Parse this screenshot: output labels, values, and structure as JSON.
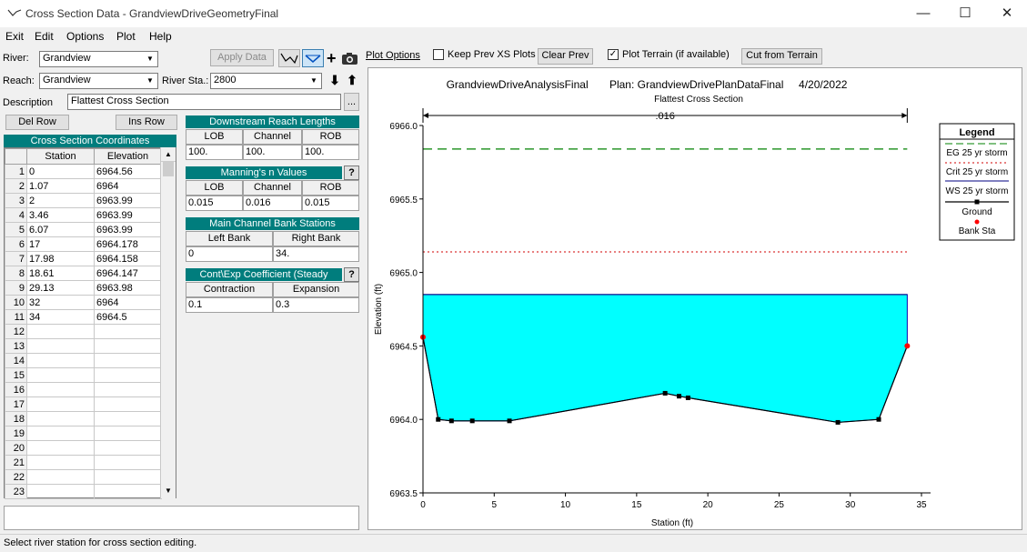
{
  "window": {
    "title": "Cross Section Data - GrandviewDriveGeometryFinal",
    "min": "—",
    "max": "☐",
    "close": "✕"
  },
  "menu": [
    "Exit",
    "Edit",
    "Options",
    "Plot",
    "Help"
  ],
  "river": {
    "label": "River:",
    "value": "Grandview"
  },
  "reach": {
    "label": "Reach:",
    "value": "Grandview"
  },
  "river_sta": {
    "label": "River Sta.:",
    "value": "2800"
  },
  "apply_data": "Apply Data",
  "description": {
    "label": "Description",
    "value": "Flattest Cross Section"
  },
  "ellipsis": "...",
  "del_row": "Del Row",
  "ins_row": "Ins Row",
  "coords": {
    "title": "Cross Section Coordinates",
    "headers": [
      "Station",
      "Elevation"
    ],
    "rows": [
      [
        "1",
        "0",
        "6964.56"
      ],
      [
        "2",
        "1.07",
        "6964"
      ],
      [
        "3",
        "2",
        "6963.99"
      ],
      [
        "4",
        "3.46",
        "6963.99"
      ],
      [
        "5",
        "6.07",
        "6963.99"
      ],
      [
        "6",
        "17",
        "6964.178"
      ],
      [
        "7",
        "17.98",
        "6964.158"
      ],
      [
        "8",
        "18.61",
        "6964.147"
      ],
      [
        "9",
        "29.13",
        "6963.98"
      ],
      [
        "10",
        "32",
        "6964"
      ],
      [
        "11",
        "34",
        "6964.5"
      ],
      [
        "12",
        "",
        ""
      ],
      [
        "13",
        "",
        ""
      ],
      [
        "14",
        "",
        ""
      ],
      [
        "15",
        "",
        ""
      ],
      [
        "16",
        "",
        ""
      ],
      [
        "17",
        "",
        ""
      ],
      [
        "18",
        "",
        ""
      ],
      [
        "19",
        "",
        ""
      ],
      [
        "20",
        "",
        ""
      ],
      [
        "21",
        "",
        ""
      ],
      [
        "22",
        "",
        ""
      ],
      [
        "23",
        "",
        ""
      ]
    ]
  },
  "reach_lengths": {
    "title": "Downstream Reach Lengths",
    "headers": [
      "LOB",
      "Channel",
      "ROB"
    ],
    "values": [
      "100.",
      "100.",
      "100."
    ]
  },
  "mannings": {
    "title": "Manning's n Values",
    "headers": [
      "LOB",
      "Channel",
      "ROB"
    ],
    "values": [
      "0.015",
      "0.016",
      "0.015"
    ]
  },
  "bank_stations": {
    "title": "Main Channel Bank Stations",
    "headers": [
      "Left Bank",
      "Right Bank"
    ],
    "values": [
      "0",
      "34."
    ]
  },
  "cont_exp": {
    "title": "Cont\\Exp Coefficient (Steady",
    "headers": [
      "Contraction",
      "Expansion"
    ],
    "values": [
      "0.1",
      "0.3"
    ]
  },
  "help_glyph": "?",
  "plot_options": "Plot Options",
  "keep_prev": "Keep Prev XS Plots",
  "clear_prev": "Clear Prev",
  "plot_terrain": "Plot Terrain (if available)",
  "cut_terrain": "Cut from Terrain",
  "status_text": "Select river station for cross section editing.",
  "colors": {
    "water": "#00ffff",
    "teal": "#007d7d",
    "eg": "#008000",
    "crit": "#d00000",
    "ground": "#000000",
    "bank": "#ff0000"
  },
  "icons": [
    "draw-xs-icon",
    "water-surface-icon",
    "plus-icon",
    "camera-icon",
    "arrow-down-icon",
    "arrow-up-icon"
  ],
  "chart_data": {
    "type": "line",
    "title": "GrandviewDriveAnalysisFinal       Plan: GrandviewDrivePlanDataFinal     4/20/2022",
    "subtitle": "Flattest Cross Section",
    "xlabel": "Station (ft)",
    "ylabel": "Elevation (ft)",
    "xlim": [
      0,
      35
    ],
    "ylim": [
      6963.5,
      6966.0
    ],
    "xticks": [
      0,
      5,
      10,
      15,
      20,
      25,
      30,
      35
    ],
    "yticks": [
      6963.5,
      6964.0,
      6964.5,
      6965.0,
      6965.5,
      6966.0
    ],
    "ytick_labels": [
      "6963.5",
      "6964.0",
      "6964.5",
      "6965.0",
      "6965.5",
      "6966.0"
    ],
    "n_label": ".016",
    "legend": {
      "title": "Legend",
      "placement": "right",
      "items": [
        "EG 25 yr storm",
        "Crit 25 yr storm",
        "WS 25 yr storm",
        "Ground",
        "Bank Sta"
      ]
    },
    "series": [
      {
        "name": "Ground",
        "x": [
          0,
          1.07,
          2,
          3.46,
          6.07,
          17,
          17.98,
          18.61,
          29.13,
          32,
          34
        ],
        "y": [
          6964.56,
          6964,
          6963.99,
          6963.99,
          6963.99,
          6964.178,
          6964.158,
          6964.147,
          6963.98,
          6964,
          6964.5
        ]
      },
      {
        "name": "EG 25 yr storm",
        "x": [
          0,
          34
        ],
        "y": [
          6965.84,
          6965.84
        ]
      },
      {
        "name": "Crit 25 yr storm",
        "x": [
          0,
          34
        ],
        "y": [
          6965.14,
          6965.14
        ]
      },
      {
        "name": "WS 25 yr storm",
        "x": [
          0,
          34
        ],
        "y": [
          6964.85,
          6964.85
        ]
      },
      {
        "name": "Bank Sta",
        "x": [
          0,
          34
        ],
        "y": [
          6964.56,
          6964.5
        ]
      }
    ]
  }
}
